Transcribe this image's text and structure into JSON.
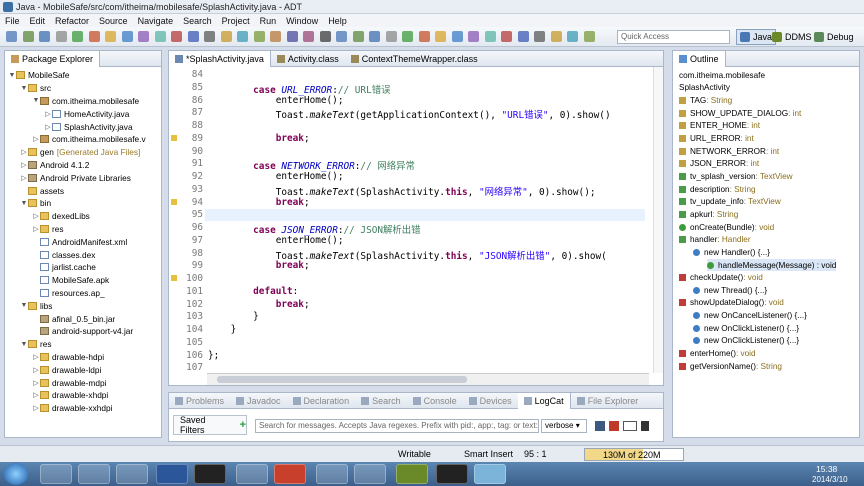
{
  "window": {
    "title": "Java - MobileSafe/src/com/itheima/mobilesafe/SplashActivity.java - ADT"
  },
  "menu": [
    "File",
    "Edit",
    "Refactor",
    "Source",
    "Navigate",
    "Search",
    "Project",
    "Run",
    "Window",
    "Help"
  ],
  "toolbar": {
    "quick_access": "Quick Access"
  },
  "perspectives": [
    {
      "label": "Java",
      "active": true
    },
    {
      "label": "DDMS",
      "active": false
    },
    {
      "label": "Debug",
      "active": false
    }
  ],
  "package_explorer": {
    "title": "Package Explorer",
    "items": [
      {
        "label": "MobileSafe",
        "depth": 0,
        "icon": "project",
        "tw": "▼"
      },
      {
        "label": "src",
        "depth": 1,
        "icon": "folder",
        "tw": "▼"
      },
      {
        "label": "com.itheima.mobilesafe",
        "depth": 2,
        "icon": "pkg",
        "tw": "▼"
      },
      {
        "label": "HomeActivity.java",
        "depth": 3,
        "icon": "jfile",
        "tw": "▷"
      },
      {
        "label": "SplashActivity.java",
        "depth": 3,
        "icon": "jfile",
        "tw": "▷"
      },
      {
        "label": "com.itheima.mobilesafe.v",
        "depth": 2,
        "icon": "pkg",
        "tw": "▷"
      },
      {
        "label": "gen",
        "depth": 1,
        "icon": "folder",
        "tw": "▷",
        "suffix": "[Generated Java Files]"
      },
      {
        "label": "Android 4.1.2",
        "depth": 1,
        "icon": "lib",
        "tw": "▷"
      },
      {
        "label": "Android Private Libraries",
        "depth": 1,
        "icon": "lib",
        "tw": "▷"
      },
      {
        "label": "assets",
        "depth": 1,
        "icon": "folder",
        "tw": ""
      },
      {
        "label": "bin",
        "depth": 1,
        "icon": "folder",
        "tw": "▼"
      },
      {
        "label": "dexedLibs",
        "depth": 2,
        "icon": "folder",
        "tw": "▷"
      },
      {
        "label": "res",
        "depth": 2,
        "icon": "folder",
        "tw": "▷"
      },
      {
        "label": "AndroidManifest.xml",
        "depth": 2,
        "icon": "jfile",
        "tw": ""
      },
      {
        "label": "classes.dex",
        "depth": 2,
        "icon": "jfile",
        "tw": ""
      },
      {
        "label": "jarlist.cache",
        "depth": 2,
        "icon": "jfile",
        "tw": ""
      },
      {
        "label": "MobileSafe.apk",
        "depth": 2,
        "icon": "jfile",
        "tw": ""
      },
      {
        "label": "resources.ap_",
        "depth": 2,
        "icon": "jfile",
        "tw": ""
      },
      {
        "label": "libs",
        "depth": 1,
        "icon": "folder",
        "tw": "▼"
      },
      {
        "label": "afinal_0.5_bin.jar",
        "depth": 2,
        "icon": "lib",
        "tw": ""
      },
      {
        "label": "android-support-v4.jar",
        "depth": 2,
        "icon": "lib",
        "tw": ""
      },
      {
        "label": "res",
        "depth": 1,
        "icon": "folder",
        "tw": "▼"
      },
      {
        "label": "drawable-hdpi",
        "depth": 2,
        "icon": "folder",
        "tw": "▷"
      },
      {
        "label": "drawable-ldpi",
        "depth": 2,
        "icon": "folder",
        "tw": "▷"
      },
      {
        "label": "drawable-mdpi",
        "depth": 2,
        "icon": "folder",
        "tw": "▷"
      },
      {
        "label": "drawable-xhdpi",
        "depth": 2,
        "icon": "folder",
        "tw": "▷"
      },
      {
        "label": "drawable-xxhdpi",
        "depth": 2,
        "icon": "folder",
        "tw": "▷"
      }
    ]
  },
  "editor": {
    "tabs": [
      {
        "label": "*SplashActivity.java",
        "active": true
      },
      {
        "label": "Activity.class",
        "active": false
      },
      {
        "label": "ContextThemeWrapper.class",
        "active": false
      }
    ],
    "lines": [
      {
        "n": "84",
        "html": ""
      },
      {
        "n": "85",
        "html": "        <span class='kw'>case</span> <span class='cst'>URL_ERROR</span>:<span class='cmt'>// URL错误</span>"
      },
      {
        "n": "86",
        "html": "            enterHome();"
      },
      {
        "n": "87",
        "html": "            Toast.<span class='it'>makeText</span>(getApplicationContext(), <span class='str'>\"URL错误\"</span>, 0).show()"
      },
      {
        "n": "88",
        "html": ""
      },
      {
        "n": "89",
        "html": "            <span class='kw'>break</span>;"
      },
      {
        "n": "90",
        "html": ""
      },
      {
        "n": "91",
        "html": "        <span class='kw'>case</span> <span class='cst'>NETWORK_ERROR</span>:<span class='cmt'>// 网络异常</span>"
      },
      {
        "n": "92",
        "html": "            enterHome();"
      },
      {
        "n": "93",
        "html": "            Toast.<span class='it'>makeText</span>(SplashActivity.<span class='kw'>this</span>, <span class='str'>\"网络异常\"</span>, 0).show();"
      },
      {
        "n": "94",
        "html": "            <span class='kw'>break</span>;"
      },
      {
        "n": "95",
        "html": ""
      },
      {
        "n": "96",
        "html": "        <span class='kw'>case</span> <span class='cst'>JSON_ERROR</span>:<span class='cmt'>// JSON解析出错</span>"
      },
      {
        "n": "97",
        "html": "            enterHome();"
      },
      {
        "n": "98",
        "html": "            Toast.<span class='it'>makeText</span>(SplashActivity.<span class='kw'>this</span>, <span class='str'>\"JSON解析出错\"</span>, 0).show("
      },
      {
        "n": "99",
        "html": "            <span class='kw'>break</span>;"
      },
      {
        "n": "100",
        "html": ""
      },
      {
        "n": "101",
        "html": "        <span class='kw'>default</span>:"
      },
      {
        "n": "102",
        "html": "            <span class='kw'>break</span>;"
      },
      {
        "n": "103",
        "html": "        }"
      },
      {
        "n": "104",
        "html": "    }"
      },
      {
        "n": "105",
        "html": ""
      },
      {
        "n": "106",
        "html": "};"
      },
      {
        "n": "107",
        "html": ""
      }
    ]
  },
  "outline": {
    "title": "Outline",
    "items": [
      {
        "label": "com.itheima.mobilesafe",
        "type": "",
        "icon": "pkg",
        "depth": 0
      },
      {
        "label": "SplashActivity",
        "type": "",
        "icon": "class",
        "depth": 0
      },
      {
        "label": "TAG",
        "type": " : String",
        "icon": "sf",
        "depth": 0
      },
      {
        "label": "SHOW_UPDATE_DIALOG",
        "type": " : int",
        "icon": "sf",
        "depth": 0
      },
      {
        "label": "ENTER_HOME",
        "type": " : int",
        "icon": "sf",
        "depth": 0
      },
      {
        "label": "URL_ERROR",
        "type": " : int",
        "icon": "sf",
        "depth": 0
      },
      {
        "label": "NETWORK_ERROR",
        "type": " : int",
        "icon": "sf",
        "depth": 0
      },
      {
        "label": "JSON_ERROR",
        "type": " : int",
        "icon": "sf",
        "depth": 0
      },
      {
        "label": "tv_splash_version",
        "type": " : TextView",
        "icon": "field",
        "depth": 0
      },
      {
        "label": "description",
        "type": " : String",
        "icon": "field",
        "depth": 0
      },
      {
        "label": "tv_update_info",
        "type": " : TextView",
        "icon": "field",
        "depth": 0
      },
      {
        "label": "apkurl",
        "type": " : String",
        "icon": "field",
        "depth": 0
      },
      {
        "label": "onCreate(Bundle)",
        "type": " : void",
        "icon": "method",
        "depth": 0
      },
      {
        "label": "handler",
        "type": " : Handler",
        "icon": "field",
        "depth": 0
      },
      {
        "label": "new Handler() {...}",
        "type": "",
        "icon": "anon",
        "depth": 1
      },
      {
        "label": "handleMessage(Message) : void",
        "type": "",
        "icon": "method",
        "depth": 2
      },
      {
        "label": "checkUpdate()",
        "type": " : void",
        "icon": "pmethod",
        "depth": 0
      },
      {
        "label": "new Thread() {...}",
        "type": "",
        "icon": "anon",
        "depth": 1
      },
      {
        "label": "showUpdateDialog()",
        "type": " : void",
        "icon": "pmethod",
        "depth": 0
      },
      {
        "label": "new OnCancelListener() {...}",
        "type": "",
        "icon": "anon",
        "depth": 1
      },
      {
        "label": "new OnClickListener() {...}",
        "type": "",
        "icon": "anon",
        "depth": 1
      },
      {
        "label": "new OnClickListener() {...}",
        "type": "",
        "icon": "anon",
        "depth": 1
      },
      {
        "label": "enterHome()",
        "type": " : void",
        "icon": "pmethod",
        "depth": 0
      },
      {
        "label": "getVersionName()",
        "type": " : String",
        "icon": "pmethod",
        "depth": 0
      }
    ]
  },
  "bottom_tabs": [
    "Problems",
    "Javadoc",
    "Declaration",
    "Search",
    "Console",
    "Devices",
    "LogCat",
    "File Explorer"
  ],
  "logcat": {
    "saved_filters": "Saved Filters",
    "search_placeholder": "Search for messages. Accepts Java regexes. Prefix with pid:, app:, tag: or text:",
    "level": "verbose"
  },
  "status": {
    "writable": "Writable",
    "insert": "Smart Insert",
    "position": "95 : 1",
    "memory": "130M of 220M"
  },
  "clock": {
    "time": "15:38",
    "date": "2014/3/10"
  }
}
